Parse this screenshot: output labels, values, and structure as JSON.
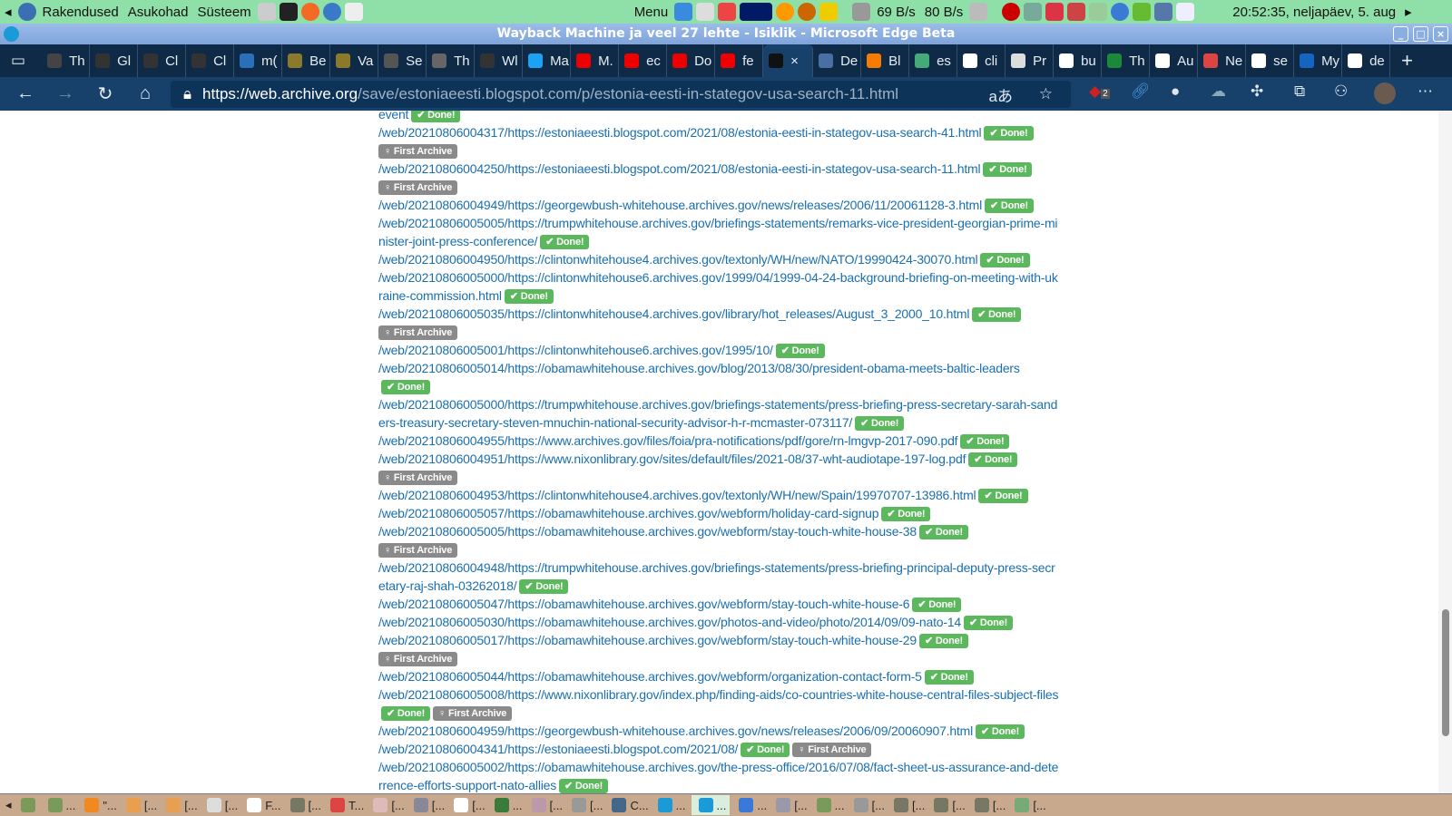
{
  "panel": {
    "menus": [
      "Rakendused",
      "Asukohad",
      "Süsteem"
    ],
    "menu_label": "Menu",
    "net_down": "69 B/s",
    "net_up": "80 B/s",
    "clock": "20:52:35, neljapäev,  5. aug"
  },
  "window": {
    "title": "Wayback Machine ja veel 27 lehte - Isiklik - Microsoft Edge Beta"
  },
  "tabs": [
    {
      "label": "Th",
      "color": "#444"
    },
    {
      "label": "Gl",
      "color": "#333"
    },
    {
      "label": "Cl",
      "color": "#333"
    },
    {
      "label": "Cl",
      "color": "#333"
    },
    {
      "label": "m(",
      "color": "#2a6fb8"
    },
    {
      "label": "Be",
      "color": "#8a7a2a"
    },
    {
      "label": "Va",
      "color": "#8a7a2a"
    },
    {
      "label": "Se",
      "color": "#555"
    },
    {
      "label": "Th",
      "color": "#666"
    },
    {
      "label": "Wl",
      "color": "#333"
    },
    {
      "label": "Ma",
      "color": "#1da1f2"
    },
    {
      "label": "M.",
      "color": "#e00"
    },
    {
      "label": "ec",
      "color": "#e00"
    },
    {
      "label": "Do",
      "color": "#e00"
    },
    {
      "label": "fe",
      "color": "#e00"
    },
    {
      "label": "×",
      "color": "#111",
      "active": true
    },
    {
      "label": "De",
      "color": "#4a6fa5"
    },
    {
      "label": "Bl",
      "color": "#f57c00"
    },
    {
      "label": "es",
      "color": "#4a7"
    },
    {
      "label": "cli",
      "color": "#fff"
    },
    {
      "label": "Pr",
      "color": "#ddd"
    },
    {
      "label": "bu",
      "color": "#fff"
    },
    {
      "label": "Th",
      "color": "#1a8a3a"
    },
    {
      "label": "Au",
      "color": "#fff"
    },
    {
      "label": "Ne",
      "color": "#d44"
    },
    {
      "label": "se",
      "color": "#fff"
    },
    {
      "label": "My",
      "color": "#1565c0"
    },
    {
      "label": "de",
      "color": "#fff"
    }
  ],
  "address": {
    "scheme": "https://",
    "host": "web.archive.org",
    "path": "/save/estoniaeesti.blogspot.com/p/estonia-eesti-in-stategov-usa-search-11.html",
    "ext_badge": "2"
  },
  "entries": [
    {
      "url": "event",
      "badges": [
        "Done!"
      ]
    },
    {
      "url": "/web/20210806004317/https://estoniaeesti.blogspot.com/2021/08/estonia-eesti-in-stategov-usa-search-41.html",
      "badges": [
        "Done!"
      ]
    },
    {
      "url": "",
      "badges": [
        "First Archive"
      ]
    },
    {
      "url": "/web/20210806004250/https://estoniaeesti.blogspot.com/2021/08/estonia-eesti-in-stategov-usa-search-11.html",
      "badges": [
        "Done!"
      ]
    },
    {
      "url": "",
      "badges": [
        "First Archive"
      ]
    },
    {
      "url": "/web/20210806004949/https://georgewbush-whitehouse.archives.gov/news/releases/2006/11/20061128-3.html",
      "badges": [
        "Done!"
      ]
    },
    {
      "url": "/web/20210806005005/https://trumpwhitehouse.archives.gov/briefings-statements/remarks-vice-president-georgian-prime-minister-joint-press-conference/",
      "badges": [
        "Done!"
      ]
    },
    {
      "url": "/web/20210806004950/https://clintonwhitehouse4.archives.gov/textonly/WH/new/NATO/19990424-30070.html",
      "badges": [
        "Done!"
      ]
    },
    {
      "url": "/web/20210806005000/https://clintonwhitehouse6.archives.gov/1999/04/1999-04-24-background-briefing-on-meeting-with-ukraine-commission.html",
      "badges": [
        "Done!"
      ]
    },
    {
      "url": "/web/20210806005035/https://clintonwhitehouse4.archives.gov/library/hot_releases/August_3_2000_10.html",
      "badges": [
        "Done!"
      ]
    },
    {
      "url": "",
      "badges": [
        "First Archive"
      ]
    },
    {
      "url": "/web/20210806005001/https://clintonwhitehouse6.archives.gov/1995/10/",
      "badges": [
        "Done!"
      ]
    },
    {
      "url": "/web/20210806005014/https://obamawhitehouse.archives.gov/blog/2013/08/30/president-obama-meets-baltic-leaders",
      "badges": [
        "Done!"
      ]
    },
    {
      "url": "/web/20210806005000/https://trumpwhitehouse.archives.gov/briefings-statements/press-briefing-press-secretary-sarah-sanders-treasury-secretary-steven-mnuchin-national-security-advisor-h-r-mcmaster-073117/",
      "badges": [
        "Done!"
      ]
    },
    {
      "url": "/web/20210806004955/https://www.archives.gov/files/foia/pra-notifications/pdf/gore/rn-lmgvp-2017-090.pdf",
      "badges": [
        "Done!"
      ]
    },
    {
      "url": "/web/20210806004951/https://www.nixonlibrary.gov/sites/default/files/2021-08/37-wht-audiotape-197-log.pdf",
      "badges": [
        "Done!"
      ]
    },
    {
      "url": "",
      "badges": [
        "First Archive"
      ]
    },
    {
      "url": "/web/20210806004953/https://clintonwhitehouse4.archives.gov/textonly/WH/new/Spain/19970707-13986.html",
      "badges": [
        "Done!"
      ]
    },
    {
      "url": "/web/20210806005057/https://obamawhitehouse.archives.gov/webform/holiday-card-signup",
      "badges": [
        "Done!"
      ]
    },
    {
      "url": "/web/20210806005005/https://obamawhitehouse.archives.gov/webform/stay-touch-white-house-38",
      "badges": [
        "Done!"
      ]
    },
    {
      "url": "",
      "badges": [
        "First Archive"
      ]
    },
    {
      "url": "/web/20210806004948/https://trumpwhitehouse.archives.gov/briefings-statements/press-briefing-principal-deputy-press-secretary-raj-shah-03262018/",
      "badges": [
        "Done!"
      ]
    },
    {
      "url": "/web/20210806005047/https://obamawhitehouse.archives.gov/webform/stay-touch-white-house-6",
      "badges": [
        "Done!"
      ]
    },
    {
      "url": "/web/20210806005030/https://obamawhitehouse.archives.gov/photos-and-video/photo/2014/09/09-nato-14",
      "badges": [
        "Done!"
      ]
    },
    {
      "url": "/web/20210806005017/https://obamawhitehouse.archives.gov/webform/stay-touch-white-house-29",
      "badges": [
        "Done!"
      ]
    },
    {
      "url": "",
      "badges": [
        "First Archive"
      ]
    },
    {
      "url": "/web/20210806005044/https://obamawhitehouse.archives.gov/webform/organization-contact-form-5",
      "badges": [
        "Done!"
      ]
    },
    {
      "url": "/web/20210806005008/https://www.nixonlibrary.gov/index.php/finding-aids/co-countries-white-house-central-files-subject-files",
      "badges": [
        "Done!",
        "First Archive"
      ]
    },
    {
      "url": "/web/20210806004959/https://georgewbush-whitehouse.archives.gov/news/releases/2006/09/20060907.html",
      "badges": [
        "Done!"
      ]
    },
    {
      "url": "/web/20210806004341/https://estoniaeesti.blogspot.com/2021/08/",
      "badges": [
        "Done!",
        "First Archive"
      ]
    },
    {
      "url": "/web/20210806005002/https://obamawhitehouse.archives.gov/the-press-office/2016/07/08/fact-sheet-us-assurance-and-deterrence-efforts-support-nato-allies",
      "badges": [
        "Done!"
      ]
    }
  ],
  "taskbar": [
    {
      "label": "",
      "color": "#7a9a5a"
    },
    {
      "label": "...",
      "color": "#7a9a5a"
    },
    {
      "label": "\"...",
      "color": "#f08a20"
    },
    {
      "label": "[...",
      "color": "#e8a050"
    },
    {
      "label": "[...",
      "color": "#e8a050"
    },
    {
      "label": "[...",
      "color": "#ddd"
    },
    {
      "label": "F...",
      "color": "#fff"
    },
    {
      "label": "[...",
      "color": "#776"
    },
    {
      "label": "T...",
      "color": "#d44"
    },
    {
      "label": "[...",
      "color": "#dbb"
    },
    {
      "label": "[...",
      "color": "#889"
    },
    {
      "label": "[...",
      "color": "#fff"
    },
    {
      "label": "...",
      "color": "#3a7a3a"
    },
    {
      "label": "[...",
      "color": "#b9a"
    },
    {
      "label": "[...",
      "color": "#999"
    },
    {
      "label": "C...",
      "color": "#468"
    },
    {
      "label": "...",
      "color": "#1a9ad6"
    },
    {
      "label": "...",
      "color": "#1a9ad6",
      "active": true
    },
    {
      "label": "...",
      "color": "#3a7ad6"
    },
    {
      "label": "[...",
      "color": "#99a"
    },
    {
      "label": "...",
      "color": "#7a9a5a"
    },
    {
      "label": "[...",
      "color": "#999"
    },
    {
      "label": "[...",
      "color": "#776"
    },
    {
      "label": "[...",
      "color": "#776"
    },
    {
      "label": "[...",
      "color": "#776"
    },
    {
      "label": "[...",
      "color": "#7a7"
    }
  ]
}
